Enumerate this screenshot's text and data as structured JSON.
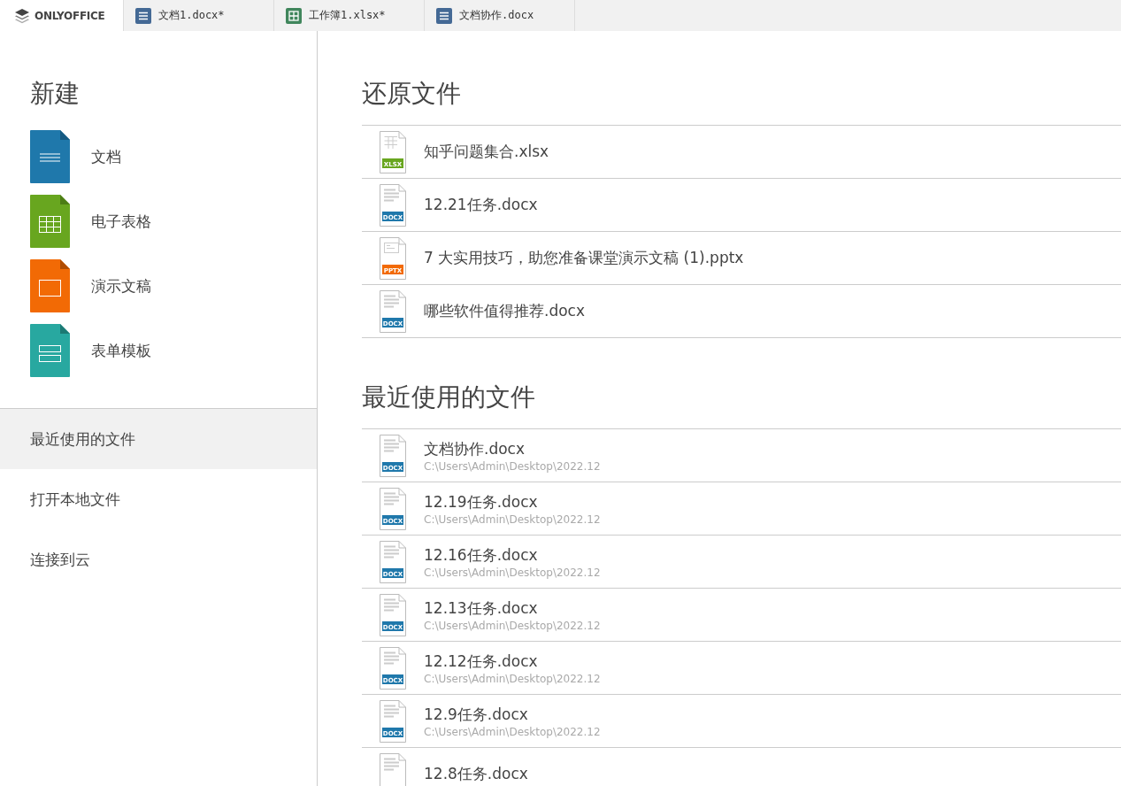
{
  "tabs": [
    {
      "kind": "logo",
      "label": "ONLYOFFICE",
      "selected": true
    },
    {
      "kind": "doc",
      "label": "文档1.docx*",
      "selected": false
    },
    {
      "kind": "sheet",
      "label": "工作簿1.xlsx*",
      "selected": false
    },
    {
      "kind": "doc",
      "label": "文档协作.docx",
      "selected": false
    }
  ],
  "sidebar": {
    "new_title": "新建",
    "create_items": [
      {
        "kind": "doc",
        "label": "文档"
      },
      {
        "kind": "sheet",
        "label": "电子表格"
      },
      {
        "kind": "slide",
        "label": "演示文稿"
      },
      {
        "kind": "form",
        "label": "表单模板"
      }
    ],
    "nav_items": [
      {
        "label": "最近使用的文件",
        "selected": true
      },
      {
        "label": "打开本地文件",
        "selected": false
      },
      {
        "label": "连接到云",
        "selected": false
      }
    ]
  },
  "recovered": {
    "title": "还原文件",
    "files": [
      {
        "kind": "sheet",
        "badge": "XLSX",
        "name": "知乎问题集合.xlsx"
      },
      {
        "kind": "doc",
        "badge": "DOCX",
        "name": "12.21任务.docx"
      },
      {
        "kind": "slide",
        "badge": "PPTX",
        "name": "7 大实用技巧，助您准备课堂演示文稿 (1).pptx"
      },
      {
        "kind": "doc",
        "badge": "DOCX",
        "name": "哪些软件值得推荐.docx"
      }
    ]
  },
  "recent": {
    "title": "最近使用的文件",
    "files": [
      {
        "kind": "doc",
        "badge": "DOCX",
        "name": "文档协作.docx",
        "path": "C:\\Users\\Admin\\Desktop\\2022.12"
      },
      {
        "kind": "doc",
        "badge": "DOCX",
        "name": "12.19任务.docx",
        "path": "C:\\Users\\Admin\\Desktop\\2022.12"
      },
      {
        "kind": "doc",
        "badge": "DOCX",
        "name": "12.16任务.docx",
        "path": "C:\\Users\\Admin\\Desktop\\2022.12"
      },
      {
        "kind": "doc",
        "badge": "DOCX",
        "name": "12.13任务.docx",
        "path": "C:\\Users\\Admin\\Desktop\\2022.12"
      },
      {
        "kind": "doc",
        "badge": "DOCX",
        "name": "12.12任务.docx",
        "path": "C:\\Users\\Admin\\Desktop\\2022.12"
      },
      {
        "kind": "doc",
        "badge": "DOCX",
        "name": "12.9任务.docx",
        "path": "C:\\Users\\Admin\\Desktop\\2022.12"
      },
      {
        "kind": "doc",
        "name": "12.8任务.docx"
      }
    ]
  }
}
